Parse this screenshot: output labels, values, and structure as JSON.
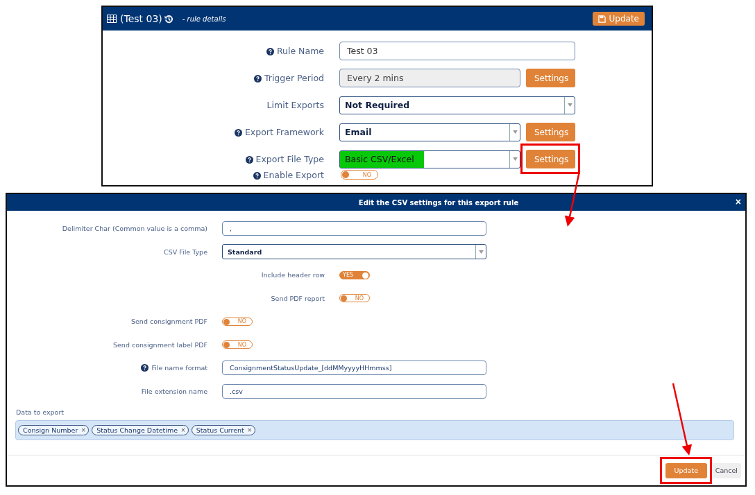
{
  "rule_panel": {
    "title": "(Test 03)",
    "subtitle": "- rule details",
    "update_button": "Update",
    "rows": [
      {
        "kind": "input",
        "label": "Rule Name",
        "help": true,
        "value": "Test 03",
        "disabled": false
      },
      {
        "kind": "input",
        "label": "Trigger Period",
        "help": true,
        "value": "Every 2 mins",
        "disabled": true,
        "button": "Settings",
        "callout": false
      },
      {
        "kind": "select",
        "label": "Limit Exports",
        "help": false,
        "value": "Not Required",
        "highlighted": false
      },
      {
        "kind": "select",
        "label": "Export Framework",
        "help": true,
        "value": "Email",
        "highlighted": false,
        "button": "Settings",
        "callout": false
      },
      {
        "kind": "select",
        "label": "Export File Type",
        "help": true,
        "value": "Basic CSV/Excel",
        "highlighted": true,
        "button": "Settings",
        "callout": true
      },
      {
        "kind": "toggle",
        "label": "Enable Export",
        "help": true,
        "on": false,
        "state_text": "NO"
      }
    ]
  },
  "csv_dialog": {
    "title": "Edit the CSV settings for this export rule",
    "close": "×",
    "rows": [
      {
        "kind": "input",
        "label": "Delimiter Char (Common value is a comma)",
        "help": false,
        "value": ","
      },
      {
        "kind": "select",
        "label": "CSV File Type",
        "help": false,
        "value": "Standard"
      },
      {
        "kind": "toggle-centered",
        "label": "Include header row",
        "help": false,
        "on": true,
        "state_text": "YES"
      },
      {
        "kind": "toggle-centered",
        "label": "Send PDF report",
        "help": false,
        "on": false,
        "state_text": "NO"
      },
      {
        "kind": "toggle",
        "label": "Send consignment PDF",
        "help": false,
        "on": false,
        "state_text": "NO"
      },
      {
        "kind": "toggle",
        "label": "Send consignment label PDF",
        "help": false,
        "on": false,
        "state_text": "NO"
      },
      {
        "kind": "input",
        "label": "File name format",
        "help": true,
        "value": "ConsignmentStatusUpdate_[ddMMyyyyHHmmss]"
      },
      {
        "kind": "input",
        "label": "File extension name",
        "help": false,
        "value": ".csv"
      }
    ],
    "data_label": "Data to export",
    "tags": [
      {
        "text": "Consign Number",
        "remove": "×"
      },
      {
        "text": "Status Change Datetime",
        "remove": "×"
      },
      {
        "text": "Status Current",
        "remove": "×"
      }
    ],
    "footer": {
      "update": {
        "label": "Update",
        "callout": true
      },
      "cancel": "Cancel"
    }
  }
}
